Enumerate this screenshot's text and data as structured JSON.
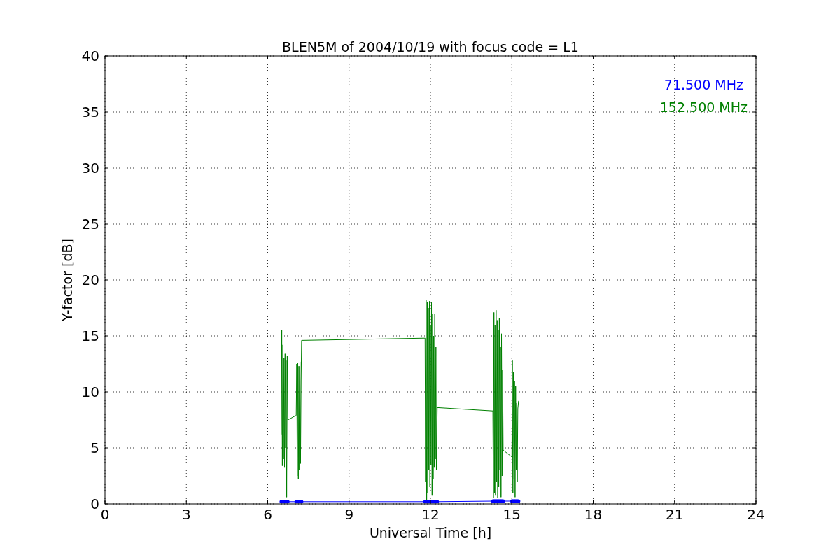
{
  "chart_data": {
    "type": "line",
    "title": "BLEN5M of 2004/10/19 with focus code = L1",
    "xlabel": "Universal Time [h]",
    "ylabel": "Y-factor [dB]",
    "x": [
      6.5,
      6.52,
      6.54,
      6.56,
      6.58,
      6.6,
      6.62,
      6.64,
      6.66,
      6.68,
      6.7,
      6.72,
      6.74,
      7.05,
      7.07,
      7.09,
      7.11,
      7.13,
      7.15,
      7.17,
      7.19,
      7.21,
      7.23,
      7.25,
      11.8,
      11.82,
      11.84,
      11.86,
      11.88,
      11.9,
      11.92,
      11.94,
      11.96,
      11.98,
      12.0,
      12.02,
      12.04,
      12.06,
      12.08,
      12.1,
      12.12,
      12.14,
      12.16,
      12.18,
      12.2,
      12.22,
      12.25,
      14.3,
      14.32,
      14.34,
      14.36,
      14.38,
      14.4,
      14.42,
      14.44,
      14.46,
      14.48,
      14.5,
      14.52,
      14.54,
      14.56,
      14.58,
      14.6,
      14.62,
      14.64,
      14.66,
      14.68,
      15.0,
      15.02,
      15.04,
      15.06,
      15.08,
      15.1,
      15.12,
      15.14,
      15.16,
      15.18,
      15.2,
      15.22,
      15.25
    ],
    "series": [
      {
        "name": "71.500 MHz",
        "color": "#0000ff",
        "marker": "circle",
        "values": [
          0.2,
          0.2,
          0.2,
          0.2,
          0.2,
          0.2,
          0.2,
          0.2,
          0.2,
          0.2,
          0.2,
          0.2,
          0.2,
          0.2,
          0.2,
          0.2,
          0.2,
          0.2,
          0.2,
          0.2,
          0.2,
          0.2,
          0.2,
          0.2,
          0.2,
          0.2,
          0.2,
          0.2,
          0.2,
          0.2,
          0.2,
          0.2,
          0.2,
          0.2,
          0.2,
          0.2,
          0.2,
          0.2,
          0.2,
          0.2,
          0.2,
          0.2,
          0.2,
          0.2,
          0.2,
          0.2,
          0.2,
          0.25,
          0.25,
          0.25,
          0.25,
          0.25,
          0.25,
          0.25,
          0.25,
          0.25,
          0.25,
          0.25,
          0.25,
          0.25,
          0.25,
          0.25,
          0.25,
          0.25,
          0.25,
          0.25,
          0.25,
          0.25,
          0.25,
          0.25,
          0.25,
          0.25,
          0.25,
          0.25,
          0.25,
          0.25,
          0.25,
          0.25,
          0.25,
          0.25
        ]
      },
      {
        "name": "152.500 MHz",
        "color": "#008000",
        "marker": "none",
        "values": [
          6.2,
          15.5,
          3.4,
          14.2,
          4.0,
          13.0,
          3.3,
          13.4,
          5.0,
          12.8,
          0.6,
          13.2,
          7.5,
          7.9,
          12.5,
          2.5,
          12.6,
          2.2,
          12.3,
          3.0,
          12.7,
          3.6,
          11.0,
          14.6,
          14.8,
          2.0,
          18.2,
          0.3,
          18.0,
          1.0,
          17.5,
          3.0,
          18.1,
          1.5,
          16.0,
          3.5,
          18.0,
          0.8,
          17.0,
          2.2,
          15.0,
          3.3,
          17.0,
          4.0,
          14.0,
          3.0,
          8.6,
          8.3,
          0.5,
          17.1,
          1.0,
          16.0,
          0.8,
          17.3,
          2.0,
          16.4,
          0.5,
          15.5,
          1.5,
          16.6,
          3.0,
          14.0,
          0.6,
          15.2,
          2.5,
          12.0,
          4.8,
          4.2,
          12.8,
          1.0,
          11.8,
          2.2,
          11.0,
          0.6,
          10.5,
          3.0,
          9.0,
          2.0,
          8.5,
          9.2
        ]
      }
    ],
    "grid": true,
    "xlim": [
      0,
      24
    ],
    "ylim": [
      0,
      40
    ],
    "xticks": [
      0,
      3,
      6,
      9,
      12,
      15,
      18,
      21,
      24
    ],
    "yticks": [
      0,
      5,
      10,
      15,
      20,
      25,
      30,
      35,
      40
    ]
  }
}
